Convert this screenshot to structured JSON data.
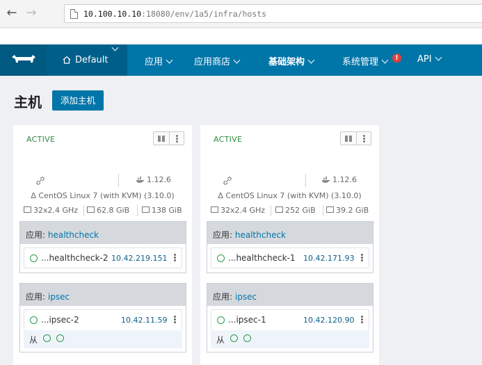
{
  "browser": {
    "back_icon": "arrow-left-icon",
    "forward_icon": "arrow-right-icon",
    "url_host": "10.100.10.10",
    "url_rest": ":18080/env/1a5/infra/hosts"
  },
  "header": {
    "env_label": "Default",
    "nav": [
      {
        "label": "应用"
      },
      {
        "label": "应用商店"
      },
      {
        "label": "基础架构"
      },
      {
        "label": "系统管理"
      },
      {
        "label": "API"
      }
    ],
    "alert_badge": "!"
  },
  "page": {
    "title": "主机",
    "add_button": "添加主机"
  },
  "hosts": [
    {
      "state": "ACTIVE",
      "docker_version": "1.12.6",
      "os": "CentOS Linux 7 (with KVM) (3.10.0)",
      "cpu": "32x2.4 GHz",
      "memory": "62.8 GiB",
      "disk": "138 GiB",
      "services": [
        {
          "prefix": "应用:",
          "name": "healthcheck",
          "container_name": "...healthcheck-2",
          "container_ip": "10.42.219.151"
        },
        {
          "prefix": "应用:",
          "name": "ipsec",
          "container_name": "...ipsec-2",
          "container_ip": "10.42.11.59",
          "sidekick_label": "从"
        }
      ]
    },
    {
      "state": "ACTIVE",
      "docker_version": "1.12.6",
      "os": "CentOS Linux 7 (with KVM) (3.10.0)",
      "cpu": "32x2.4 GHz",
      "memory": "252 GiB",
      "disk": "39.2 GiB",
      "services": [
        {
          "prefix": "应用:",
          "name": "healthcheck",
          "container_name": "...healthcheck-1",
          "container_ip": "10.42.171.93"
        },
        {
          "prefix": "应用:",
          "name": "ipsec",
          "container_name": "...ipsec-1",
          "container_ip": "10.42.120.90",
          "sidekick_label": "从"
        }
      ]
    }
  ],
  "colors": {
    "header_bg": "#0075a8",
    "logo_bg": "#005a82",
    "active_green": "#2d8a3e",
    "alert_red": "#e0403a"
  }
}
